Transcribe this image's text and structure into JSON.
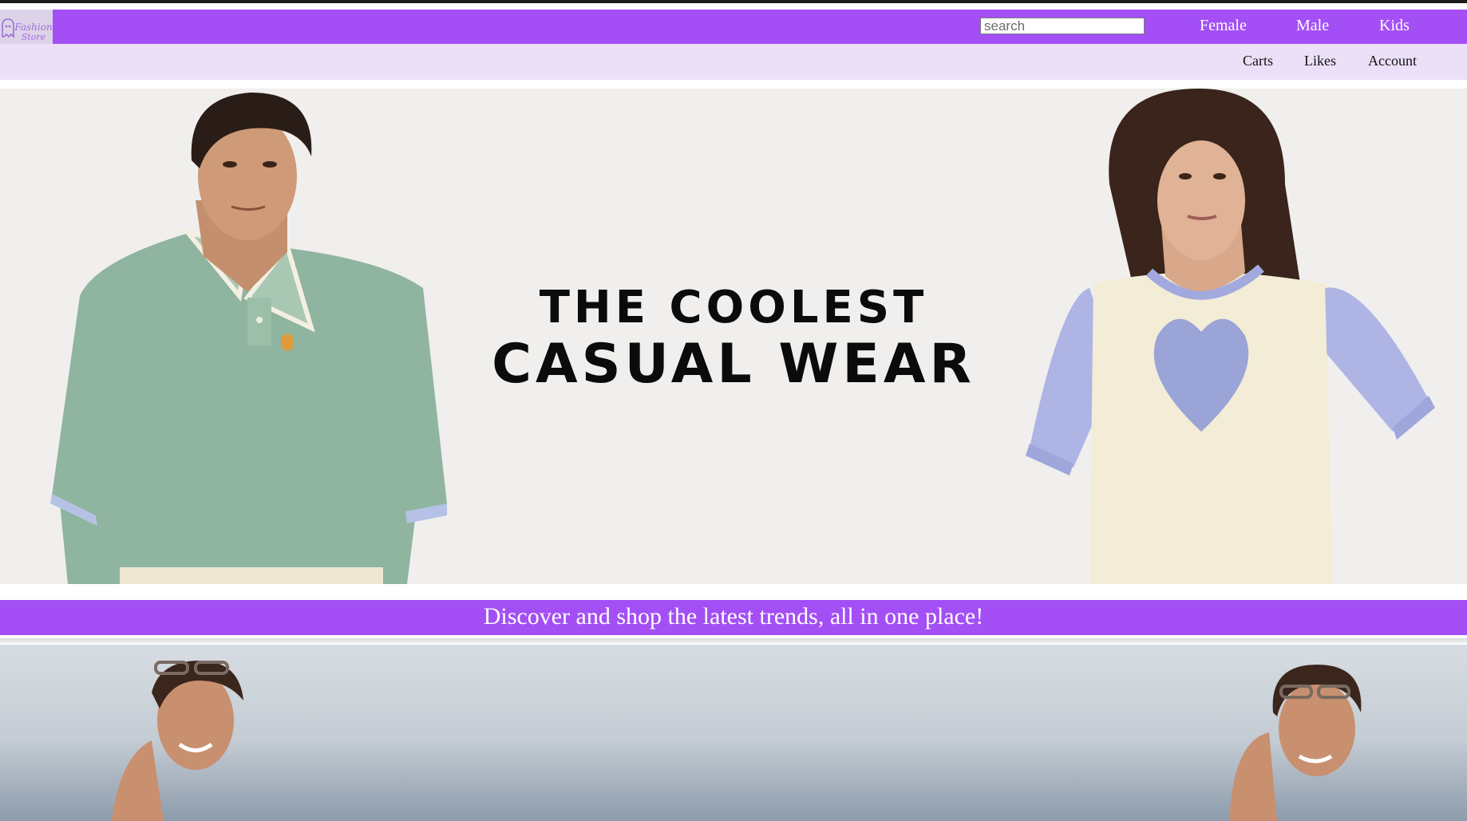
{
  "header": {
    "logo_text_1": "Fashion",
    "logo_text_2": "Store",
    "search_placeholder": "search",
    "primary_nav": [
      "Female",
      "Male",
      "Kids"
    ],
    "secondary_nav": [
      "Carts",
      "Likes",
      "Account"
    ]
  },
  "hero": {
    "title_line_1": "THE COOLEST",
    "title_line_2": "CASUAL WEAR"
  },
  "tagline": "Discover and shop the latest trends, all in one place!",
  "colors": {
    "brand_purple": "#a34ff5",
    "light_lavender": "#ebe0f8",
    "hero_background": "#f0efed"
  }
}
